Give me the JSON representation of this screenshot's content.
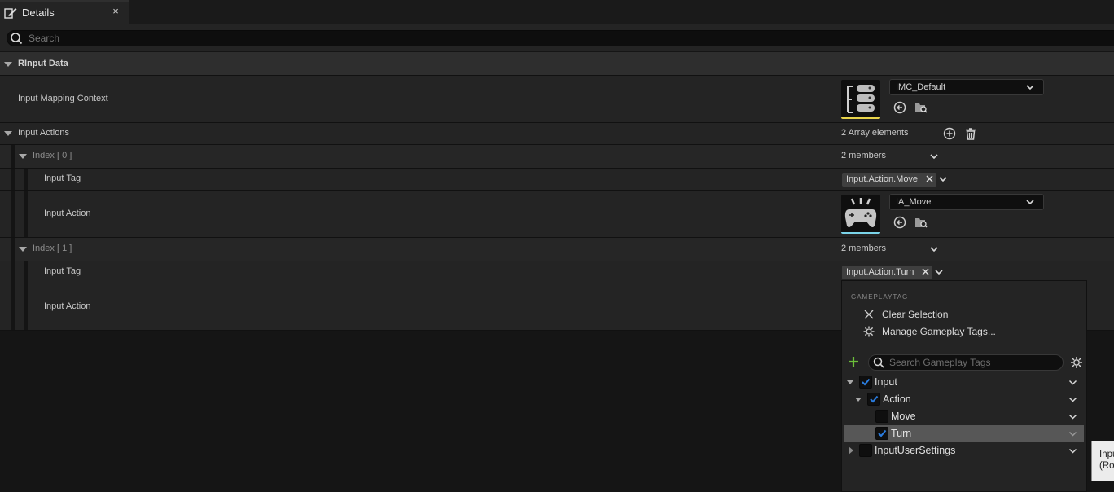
{
  "tab": {
    "title": "Details",
    "close": "×"
  },
  "search": {
    "placeholder": "Search"
  },
  "categories": {
    "rinput_data": "RInput Data",
    "input_actions": "Input Actions"
  },
  "rows": {
    "mapping_context": {
      "label": "Input Mapping Context",
      "value": "IMC_Default"
    },
    "array_count": "2 Array elements",
    "index0": {
      "label": "Index [ 0 ]",
      "members": "2 members",
      "tag_label": "Input Tag",
      "tag_value": "Input.Action.Move",
      "action_label": "Input Action",
      "action_value": "IA_Move"
    },
    "index1": {
      "label": "Index [ 1 ]",
      "members": "2 members",
      "tag_label": "Input Tag",
      "tag_value": "Input.Action.Turn",
      "action_label": "Input Action"
    }
  },
  "popup": {
    "section": "GAMEPLAYTAG",
    "clear": "Clear Selection",
    "manage": "Manage Gameplay Tags...",
    "search_placeholder": "Search Gameplay Tags",
    "tree": [
      {
        "label": "Input",
        "checked": true
      },
      {
        "label": "Action",
        "checked": true
      },
      {
        "label": "Move",
        "checked": false
      },
      {
        "label": "Turn",
        "checked": true
      },
      {
        "label": "InputUserSettings",
        "checked": false
      }
    ]
  },
  "tooltip": {
    "line1": "Inpu",
    "line2": "(Ro"
  },
  "icons": {
    "tab": "details-pencil-icon",
    "search": "magnifier-icon",
    "close": "close-icon",
    "expand": "triangle-down-icon",
    "add": "plus-circle-icon",
    "delete": "trash-icon",
    "use": "arrow-left-circle-icon",
    "browse": "folder-search-icon",
    "settings": "gear-icon"
  },
  "colors": {
    "background": "#151515",
    "panel": "#242424",
    "category": "#2e2e2e",
    "accent_yellow": "#e8d44a",
    "accent_cyan": "#7ad3e8",
    "check_blue": "#2a7de0",
    "add_green": "#6cbf3a",
    "selected_row": "#575757"
  }
}
